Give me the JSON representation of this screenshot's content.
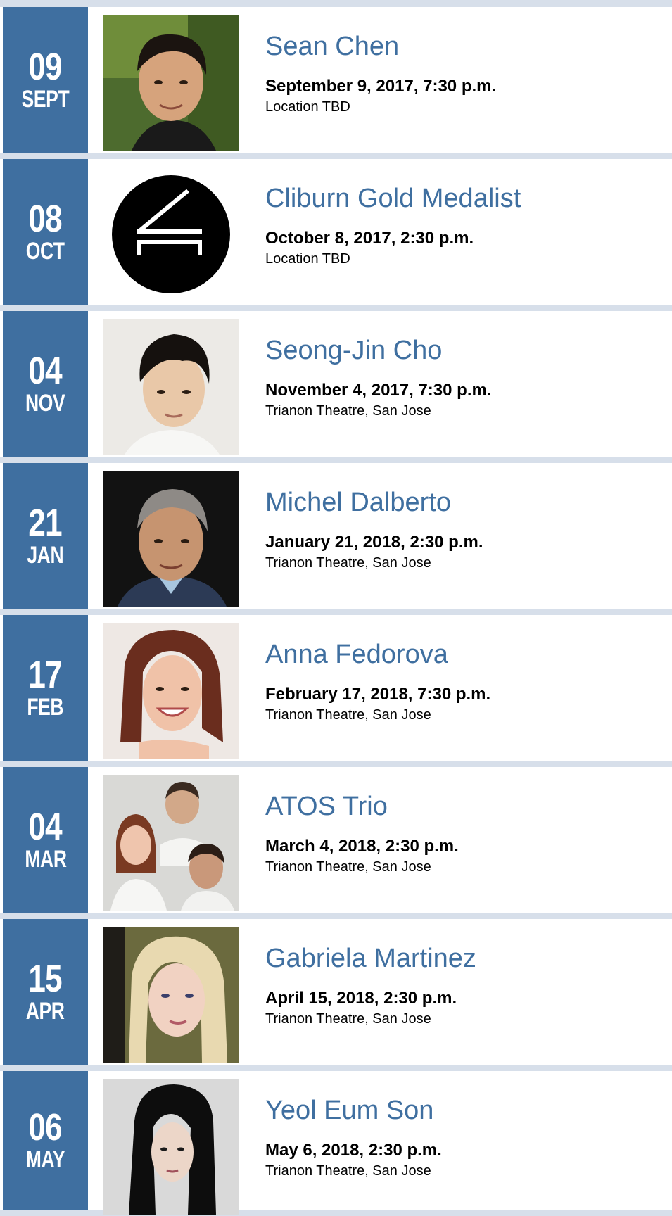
{
  "colors": {
    "accent": "#3f6fa0",
    "page_background": "#d7dfea",
    "card_background": "#ffffff"
  },
  "events": [
    {
      "day": "09",
      "month": "SEPT",
      "name": "Sean Chen",
      "datetime": "September 9, 2017, 7:30 p.m.",
      "location": "Location TBD",
      "image": "performer-photo"
    },
    {
      "day": "08",
      "month": "OCT",
      "name": "Cliburn Gold Medalist",
      "datetime": "October 8, 2017, 2:30 p.m.",
      "location": "Location TBD",
      "image": "piano-logo"
    },
    {
      "day": "04",
      "month": "NOV",
      "name": "Seong-Jin Cho",
      "datetime": "November 4, 2017, 7:30 p.m.",
      "location": "Trianon Theatre, San Jose",
      "image": "performer-photo"
    },
    {
      "day": "21",
      "month": "JAN",
      "name": "Michel Dalberto",
      "datetime": "January 21, 2018, 2:30 p.m.",
      "location": "Trianon Theatre, San Jose",
      "image": "performer-photo"
    },
    {
      "day": "17",
      "month": "FEB",
      "name": "Anna Fedorova",
      "datetime": "February 17, 2018, 7:30 p.m.",
      "location": "Trianon Theatre, San Jose",
      "image": "performer-photo"
    },
    {
      "day": "04",
      "month": "MAR",
      "name": "ATOS Trio",
      "datetime": "March 4, 2018, 2:30 p.m.",
      "location": "Trianon Theatre, San Jose",
      "image": "group-photo"
    },
    {
      "day": "15",
      "month": "APR",
      "name": "Gabriela Martinez",
      "datetime": "April 15, 2018, 2:30 p.m.",
      "location": "Trianon Theatre, San Jose",
      "image": "performer-photo"
    },
    {
      "day": "06",
      "month": "MAY",
      "name": "Yeol Eum Son",
      "datetime": "May 6, 2018, 2:30 p.m.",
      "location": "Trianon Theatre, San Jose",
      "image": "performer-photo"
    }
  ]
}
